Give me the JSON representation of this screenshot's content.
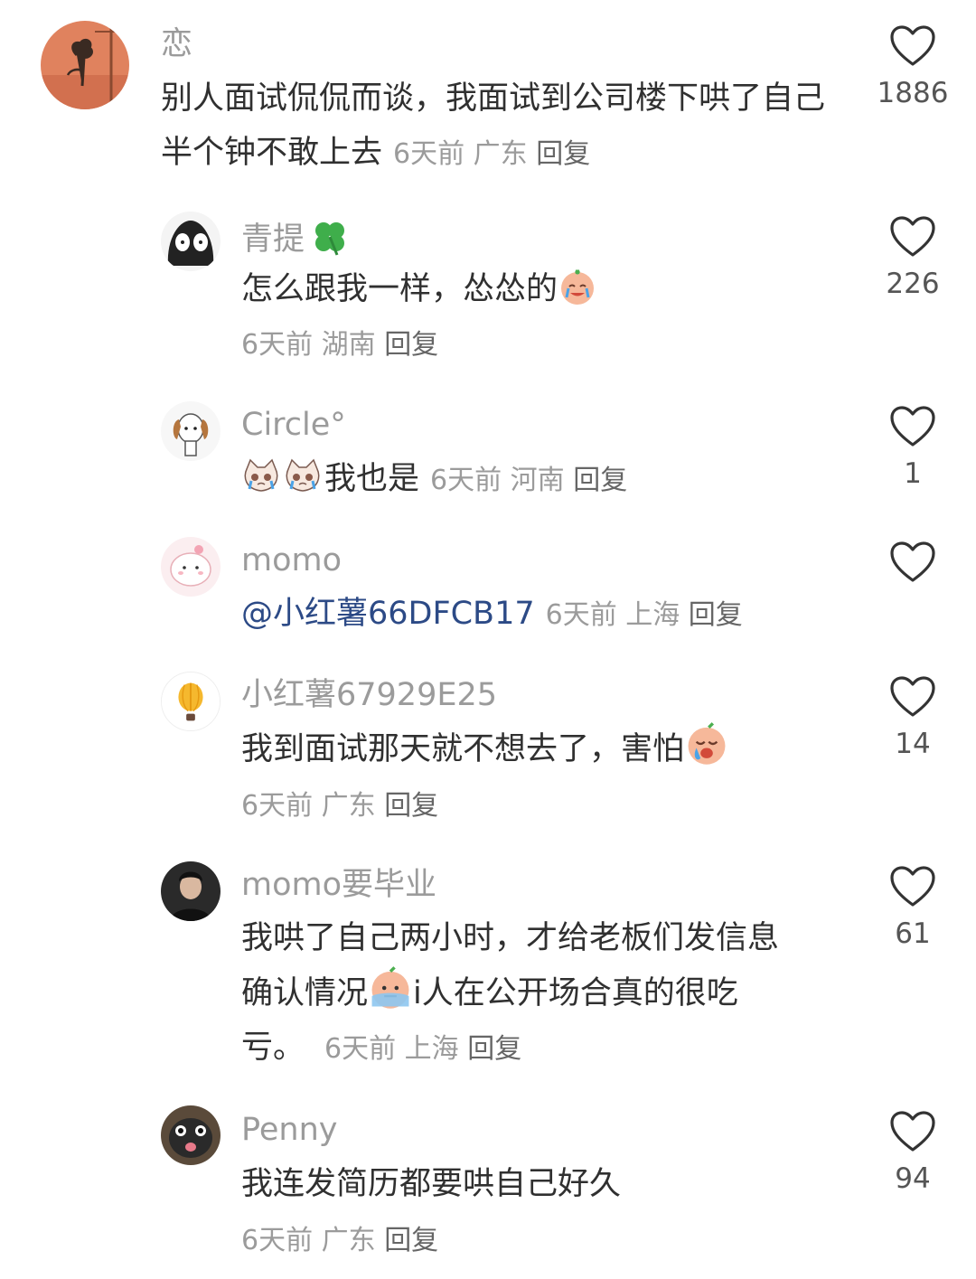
{
  "comments": [
    {
      "user": "恋",
      "text": "别人面试侃侃而谈，我面试到公司楼下哄了自己半个钟不敢上去",
      "time": "6天前",
      "location": "广东",
      "reply": "回复",
      "likes": "1886"
    },
    {
      "user": "青提",
      "user_icon": "four-leaf-clover-emoji",
      "text": "怎么跟我一样，怂怂的",
      "emoji": "crying-peach-emoji",
      "time": "6天前",
      "location": "湖南",
      "reply": "回复",
      "likes": "226"
    },
    {
      "user": "Circle°",
      "emoji": "crying-cat-emoji",
      "text": "我也是",
      "time": "6天前",
      "location": "河南",
      "reply": "回复",
      "likes": "1"
    },
    {
      "user": "momo",
      "mention": "@小红薯66DFCB17",
      "time": "6天前",
      "location": "上海",
      "reply": "回复",
      "likes": ""
    },
    {
      "user": "小红薯67929E25",
      "text": "我到面试那天就不想去了，害怕",
      "emoji": "crying-peach-emoji",
      "time": "6天前",
      "location": "广东",
      "reply": "回复",
      "likes": "14"
    },
    {
      "user": "momo要毕业",
      "text_a": "我哄了自己两小时，才给老板们发信息",
      "text_b": "确认情况",
      "emoji": "scared-peach-emoji",
      "text_c": "i人在公开场合真的很吃",
      "text_d": "亏。",
      "time": "6天前",
      "location": "上海",
      "reply": "回复",
      "likes": "61"
    },
    {
      "user": "Penny",
      "text": "我连发简历都要哄自己好久",
      "time": "6天前",
      "location": "广东",
      "reply": "回复",
      "likes": "94"
    }
  ],
  "colors": {
    "name": "#9b9b9b",
    "text": "#303030",
    "mention": "#2c4a86",
    "meta": "#9b9b9b"
  }
}
